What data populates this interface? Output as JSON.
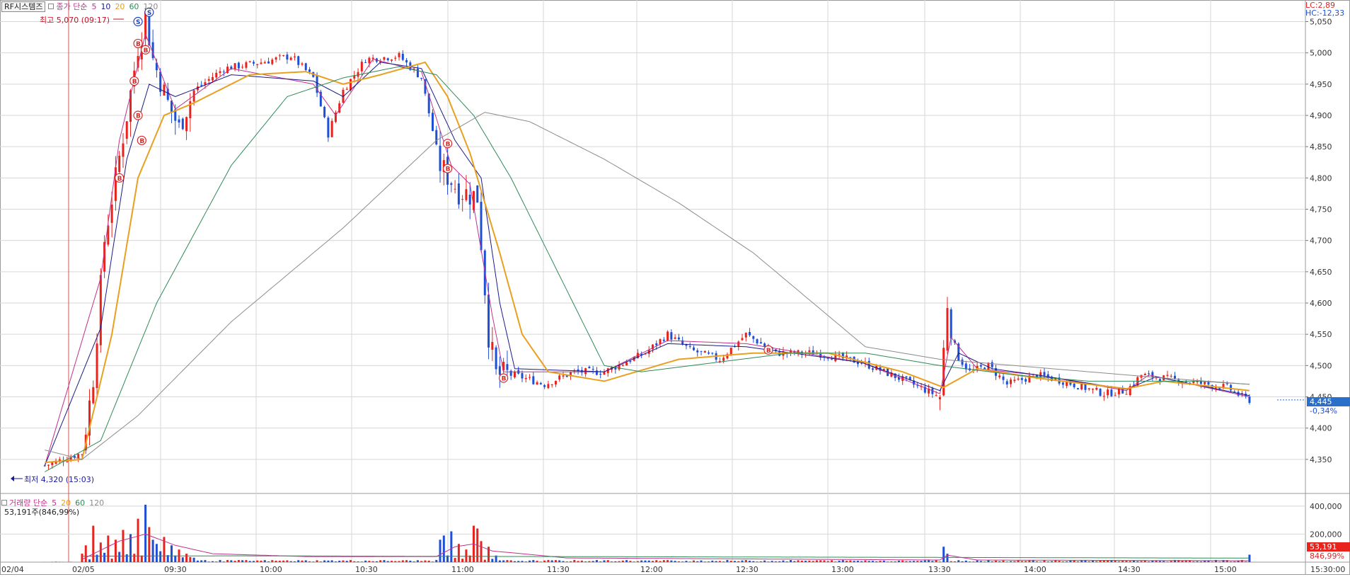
{
  "legend": {
    "symbol": "RF시스템즈",
    "price_label": "종가 단순",
    "ma_periods": [
      "5",
      "10",
      "20",
      "60",
      "120"
    ],
    "ma_colors": [
      "#c0328c",
      "#1a1a8a",
      "#e8a020",
      "#2e8b57",
      "#8c8c8c"
    ]
  },
  "volume_legend": {
    "label": "거래량 단순",
    "ma_periods": [
      "5",
      "20",
      "60",
      "120"
    ],
    "info": "53,191주(846,99%)"
  },
  "markers": {
    "high_label": "최고 5,070 (09:17)",
    "low_label": "최저 4,320 (15:03)"
  },
  "right_info": {
    "lc": "LC:2,89",
    "hc": "HC:-12,33",
    "last_price": "4,445",
    "last_change": "-0,34%",
    "last_volume": "53,191",
    "last_volume_pct": "846,99%"
  },
  "colors": {
    "up": "#e8231e",
    "down": "#1f4fd6",
    "grid": "#d7d7d7",
    "signal": "#d62a2a"
  },
  "chart_data": [
    {
      "type": "candlestick",
      "title": "RF시스템즈",
      "interval": "1-minute",
      "x_tick_labels": [
        "02/04",
        "02/05",
        "09:30",
        "10:00",
        "10:30",
        "11:00",
        "11:30",
        "12:00",
        "12:30",
        "13:00",
        "13:30",
        "14:00",
        "14:30",
        "15:00",
        "15:30:00"
      ],
      "y_tick_labels": [
        "5,050",
        "5,000",
        "4,950",
        "4,900",
        "4,850",
        "4,800",
        "4,750",
        "4,700",
        "4,650",
        "4,600",
        "4,550",
        "4,500",
        "4,450",
        "4,400",
        "4,350"
      ],
      "ylim": [
        4300,
        5080
      ],
      "grid": true,
      "price_path": [
        {
          "t": -10,
          "p": 4340
        },
        {
          "t": 0,
          "p": 4360
        },
        {
          "t": 3,
          "p": 4480
        },
        {
          "t": 6,
          "p": 4700
        },
        {
          "t": 9,
          "p": 4800
        },
        {
          "t": 12,
          "p": 4900
        },
        {
          "t": 15,
          "p": 5010
        },
        {
          "t": 17,
          "p": 5060
        },
        {
          "t": 19,
          "p": 4990
        },
        {
          "t": 23,
          "p": 4920
        },
        {
          "t": 26,
          "p": 4880
        },
        {
          "t": 30,
          "p": 4940
        },
        {
          "t": 38,
          "p": 4975
        },
        {
          "t": 48,
          "p": 4985
        },
        {
          "t": 56,
          "p": 4995
        },
        {
          "t": 62,
          "p": 4960
        },
        {
          "t": 66,
          "p": 4870
        },
        {
          "t": 70,
          "p": 4940
        },
        {
          "t": 76,
          "p": 4990
        },
        {
          "t": 85,
          "p": 4995
        },
        {
          "t": 91,
          "p": 4960
        },
        {
          "t": 96,
          "p": 4820
        },
        {
          "t": 101,
          "p": 4780
        },
        {
          "t": 106,
          "p": 4770
        },
        {
          "t": 109,
          "p": 4550
        },
        {
          "t": 111,
          "p": 4485
        },
        {
          "t": 116,
          "p": 4485
        },
        {
          "t": 124,
          "p": 4470
        },
        {
          "t": 132,
          "p": 4490
        },
        {
          "t": 140,
          "p": 4490
        },
        {
          "t": 151,
          "p": 4520
        },
        {
          "t": 157,
          "p": 4550
        },
        {
          "t": 163,
          "p": 4525
        },
        {
          "t": 171,
          "p": 4510
        },
        {
          "t": 178,
          "p": 4550
        },
        {
          "t": 186,
          "p": 4520
        },
        {
          "t": 197,
          "p": 4520
        },
        {
          "t": 209,
          "p": 4505
        },
        {
          "t": 221,
          "p": 4475
        },
        {
          "t": 230,
          "p": 4450
        },
        {
          "t": 232,
          "p": 4600
        },
        {
          "t": 234,
          "p": 4520
        },
        {
          "t": 238,
          "p": 4490
        },
        {
          "t": 243,
          "p": 4500
        },
        {
          "t": 248,
          "p": 4470
        },
        {
          "t": 256,
          "p": 4485
        },
        {
          "t": 263,
          "p": 4475
        },
        {
          "t": 274,
          "p": 4455
        },
        {
          "t": 280,
          "p": 4460
        },
        {
          "t": 284,
          "p": 4485
        },
        {
          "t": 296,
          "p": 4475
        },
        {
          "t": 307,
          "p": 4465
        },
        {
          "t": 311,
          "p": 4450
        },
        {
          "t": 313,
          "p": 4445
        }
      ],
      "ma_curves": [
        {
          "name": "5",
          "points": [
            [
              -10,
              4340
            ],
            [
              5,
              4640
            ],
            [
              10,
              4860
            ],
            [
              17,
              5030
            ],
            [
              25,
              4910
            ],
            [
              40,
              4975
            ],
            [
              62,
              4950
            ],
            [
              68,
              4900
            ],
            [
              78,
              4990
            ],
            [
              91,
              4970
            ],
            [
              99,
              4820
            ],
            [
              104,
              4790
            ],
            [
              110,
              4580
            ],
            [
              113,
              4490
            ],
            [
              140,
              4490
            ],
            [
              157,
              4540
            ],
            [
              178,
              4535
            ],
            [
              209,
              4505
            ],
            [
              230,
              4455
            ],
            [
              233,
              4545
            ],
            [
              240,
              4495
            ],
            [
              256,
              4485
            ],
            [
              280,
              4460
            ],
            [
              286,
              4485
            ],
            [
              313,
              4450
            ]
          ]
        },
        {
          "name": "10",
          "points": [
            [
              -10,
              4340
            ],
            [
              5,
              4560
            ],
            [
              12,
              4830
            ],
            [
              18,
              4950
            ],
            [
              25,
              4930
            ],
            [
              40,
              4965
            ],
            [
              62,
              4955
            ],
            [
              70,
              4930
            ],
            [
              80,
              4985
            ],
            [
              91,
              4975
            ],
            [
              100,
              4860
            ],
            [
              107,
              4800
            ],
            [
              112,
              4600
            ],
            [
              116,
              4495
            ],
            [
              140,
              4490
            ],
            [
              157,
              4535
            ],
            [
              178,
              4530
            ],
            [
              209,
              4505
            ],
            [
              230,
              4460
            ],
            [
              235,
              4520
            ],
            [
              244,
              4495
            ],
            [
              256,
              4485
            ],
            [
              280,
              4462
            ],
            [
              288,
              4482
            ],
            [
              313,
              4452
            ]
          ]
        },
        {
          "name": "20",
          "points": [
            [
              -10,
              4345
            ],
            [
              0,
              4350
            ],
            [
              8,
              4550
            ],
            [
              15,
              4800
            ],
            [
              22,
              4900
            ],
            [
              30,
              4920
            ],
            [
              45,
              4965
            ],
            [
              60,
              4970
            ],
            [
              70,
              4950
            ],
            [
              80,
              4965
            ],
            [
              92,
              4985
            ],
            [
              98,
              4930
            ],
            [
              104,
              4840
            ],
            [
              112,
              4680
            ],
            [
              118,
              4550
            ],
            [
              125,
              4490
            ],
            [
              140,
              4475
            ],
            [
              160,
              4510
            ],
            [
              180,
              4520
            ],
            [
              200,
              4520
            ],
            [
              220,
              4490
            ],
            [
              231,
              4465
            ],
            [
              240,
              4495
            ],
            [
              256,
              4480
            ],
            [
              280,
              4463
            ],
            [
              290,
              4475
            ],
            [
              313,
              4460
            ]
          ]
        },
        {
          "name": "60",
          "points": [
            [
              -10,
              4330
            ],
            [
              5,
              4380
            ],
            [
              20,
              4600
            ],
            [
              40,
              4820
            ],
            [
              55,
              4930
            ],
            [
              70,
              4960
            ],
            [
              85,
              4978
            ],
            [
              95,
              4965
            ],
            [
              105,
              4900
            ],
            [
              115,
              4800
            ],
            [
              125,
              4680
            ],
            [
              135,
              4560
            ],
            [
              140,
              4500
            ],
            [
              150,
              4490
            ],
            [
              170,
              4505
            ],
            [
              190,
              4520
            ],
            [
              210,
              4520
            ],
            [
              230,
              4500
            ],
            [
              250,
              4485
            ],
            [
              270,
              4475
            ],
            [
              300,
              4475
            ],
            [
              313,
              4470
            ]
          ]
        },
        {
          "name": "120",
          "points": [
            [
              -10,
              4365
            ],
            [
              0,
              4350
            ],
            [
              15,
              4420
            ],
            [
              40,
              4570
            ],
            [
              70,
              4720
            ],
            [
              95,
              4860
            ],
            [
              108,
              4905
            ],
            [
              120,
              4890
            ],
            [
              140,
              4830
            ],
            [
              160,
              4760
            ],
            [
              180,
              4680
            ],
            [
              200,
              4580
            ],
            [
              210,
              4530
            ],
            [
              230,
              4510
            ],
            [
              260,
              4495
            ],
            [
              290,
              4480
            ],
            [
              313,
              4470
            ]
          ]
        }
      ],
      "signals": [
        {
          "label": "S",
          "t": 15,
          "p": 5050
        },
        {
          "label": "S",
          "t": 18,
          "p": 5065
        },
        {
          "label": "B",
          "t": 15,
          "p": 5015
        },
        {
          "label": "B",
          "t": 17,
          "p": 5005
        },
        {
          "label": "B",
          "t": 14,
          "p": 4955
        },
        {
          "label": "B",
          "t": 15,
          "p": 4900
        },
        {
          "label": "B",
          "t": 16,
          "p": 4860
        },
        {
          "label": "B",
          "t": 10,
          "p": 4800
        },
        {
          "label": "B",
          "t": 98,
          "p": 4855
        },
        {
          "label": "B",
          "t": 98,
          "p": 4815
        },
        {
          "label": "B",
          "t": 113,
          "p": 4480
        },
        {
          "label": "B",
          "t": 184,
          "p": 4525
        }
      ]
    },
    {
      "type": "bar",
      "title": "거래량",
      "y_tick_labels": [
        "400,000",
        "200,000"
      ],
      "ylim": [
        0,
        470000
      ],
      "spikes": [
        {
          "t": 1,
          "v": 120000
        },
        {
          "t": 3,
          "v": 260000
        },
        {
          "t": 5,
          "v": 140000
        },
        {
          "t": 7,
          "v": 190000
        },
        {
          "t": 9,
          "v": 160000
        },
        {
          "t": 11,
          "v": 230000
        },
        {
          "t": 13,
          "v": 200000
        },
        {
          "t": 15,
          "v": 310000
        },
        {
          "t": 17,
          "v": 410000
        },
        {
          "t": 18,
          "v": 250000
        },
        {
          "t": 19,
          "v": 160000
        },
        {
          "t": 20,
          "v": 130000
        },
        {
          "t": 22,
          "v": 180000
        },
        {
          "t": 24,
          "v": 120000
        },
        {
          "t": 26,
          "v": 90000
        },
        {
          "t": 28,
          "v": 60000
        },
        {
          "t": 96,
          "v": 160000
        },
        {
          "t": 97,
          "v": 190000
        },
        {
          "t": 99,
          "v": 220000
        },
        {
          "t": 101,
          "v": 130000
        },
        {
          "t": 103,
          "v": 90000
        },
        {
          "t": 105,
          "v": 260000
        },
        {
          "t": 106,
          "v": 240000
        },
        {
          "t": 107,
          "v": 150000
        },
        {
          "t": 109,
          "v": 110000
        },
        {
          "t": 231,
          "v": 110000
        },
        {
          "t": 232,
          "v": 60000
        },
        {
          "t": 313,
          "v": 53191
        }
      ],
      "ma_line": [
        [
          0,
          20000
        ],
        [
          10,
          150000
        ],
        [
          17,
          200000
        ],
        [
          25,
          120000
        ],
        [
          35,
          60000
        ],
        [
          60,
          40000
        ],
        [
          95,
          40000
        ],
        [
          100,
          110000
        ],
        [
          105,
          130000
        ],
        [
          110,
          80000
        ],
        [
          130,
          30000
        ],
        [
          230,
          15000
        ],
        [
          232,
          50000
        ],
        [
          240,
          15000
        ],
        [
          313,
          10000
        ]
      ]
    }
  ]
}
